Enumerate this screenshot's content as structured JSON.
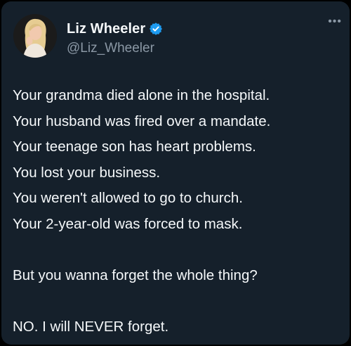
{
  "author": {
    "display_name": "Liz Wheeler",
    "handle": "@Liz_Wheeler",
    "verified": true,
    "avatar_icon": "profile-photo",
    "verified_color": "#1d9bf0"
  },
  "menu": {
    "more_label": "•••"
  },
  "tweet": {
    "lines": [
      "Your grandma died alone in the hospital.",
      "Your husband was fired over a mandate.",
      "Your teenage son has heart problems.",
      "You lost your business.",
      "You weren't allowed to go to church.",
      "Your 2-year-old was forced to mask."
    ],
    "question": "But you wanna forget the whole thing?",
    "conclusion": "NO. I will NEVER forget."
  },
  "theme": {
    "background": "#15202b",
    "text": "#f5f8fa",
    "secondary_text": "#8b98a5"
  }
}
